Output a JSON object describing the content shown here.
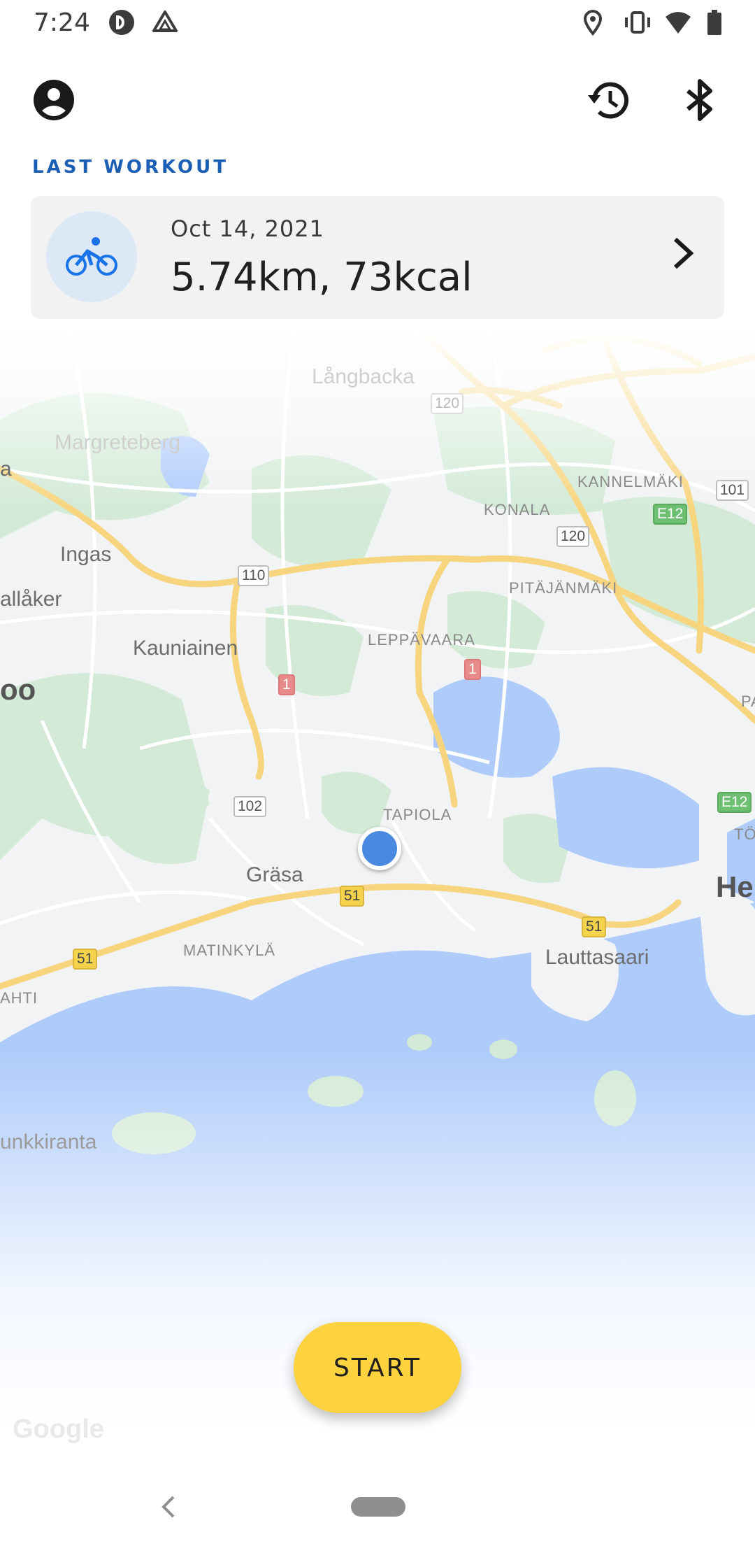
{
  "status_bar": {
    "time": "7:24",
    "icons": [
      "pocketcasts-icon",
      "drive-icon",
      "location-icon",
      "vibrate-icon",
      "wifi-icon",
      "battery-icon"
    ]
  },
  "app_bar": {
    "icons": [
      "account-icon",
      "history-icon",
      "bluetooth-icon"
    ]
  },
  "last_workout": {
    "section_label": "LAST WORKOUT",
    "date": "Oct 14, 2021",
    "metrics": "5.74km, 73kcal",
    "activity_icon": "bike-icon"
  },
  "map": {
    "places": [
      {
        "key": "langbacka",
        "label": "Långbacka"
      },
      {
        "key": "margreteberg",
        "label": "Margreteberg"
      },
      {
        "key": "ingas",
        "label": "Ingas"
      },
      {
        "key": "allaker",
        "label": "allåker"
      },
      {
        "key": "kauniainen",
        "label": "Kauniainen"
      },
      {
        "key": "oo",
        "label": "oo"
      },
      {
        "key": "leppavaara",
        "label": "LEPPÄVAARA"
      },
      {
        "key": "konala",
        "label": "KONALA"
      },
      {
        "key": "kannelmaki",
        "label": "KANNELMÄKI"
      },
      {
        "key": "pitajanmaki",
        "label": "PITÄJÄNMÄKI"
      },
      {
        "key": "pasi",
        "label": "PASI"
      },
      {
        "key": "tapiola",
        "label": "TAPIOLA"
      },
      {
        "key": "toolo",
        "label": "TÖÖLÖ"
      },
      {
        "key": "grasa",
        "label": "Gräsa"
      },
      {
        "key": "matinkyla",
        "label": "MATINKYLÄ"
      },
      {
        "key": "lauttasaari",
        "label": "Lauttasaari"
      },
      {
        "key": "he",
        "label": "He"
      },
      {
        "key": "ahti",
        "label": "AHTI"
      },
      {
        "key": "unkkiranta",
        "label": "unkkiranta"
      },
      {
        "key": "a",
        "label": "a"
      }
    ],
    "shields": [
      {
        "key": "r120a",
        "label": "120"
      },
      {
        "key": "r120b",
        "label": "120"
      },
      {
        "key": "r101",
        "label": "101"
      },
      {
        "key": "e12a",
        "label": "E12"
      },
      {
        "key": "e12b",
        "label": "E12"
      },
      {
        "key": "r110",
        "label": "110"
      },
      {
        "key": "r1a",
        "label": "1"
      },
      {
        "key": "r1b",
        "label": "1"
      },
      {
        "key": "r102",
        "label": "102"
      },
      {
        "key": "r51a",
        "label": "51"
      },
      {
        "key": "r51b",
        "label": "51"
      },
      {
        "key": "r51c",
        "label": "51"
      }
    ],
    "attribution": "Google",
    "colors": {
      "land": "#f1f3f4",
      "green": "#d3ead7",
      "water": "#aecbfa",
      "road": "#f7d57e",
      "street": "#ffffff"
    }
  },
  "start_button": {
    "label": "START",
    "color": "#fdd23f"
  },
  "nav_bar": {
    "icons": [
      "back-icon",
      "home-pill"
    ]
  }
}
